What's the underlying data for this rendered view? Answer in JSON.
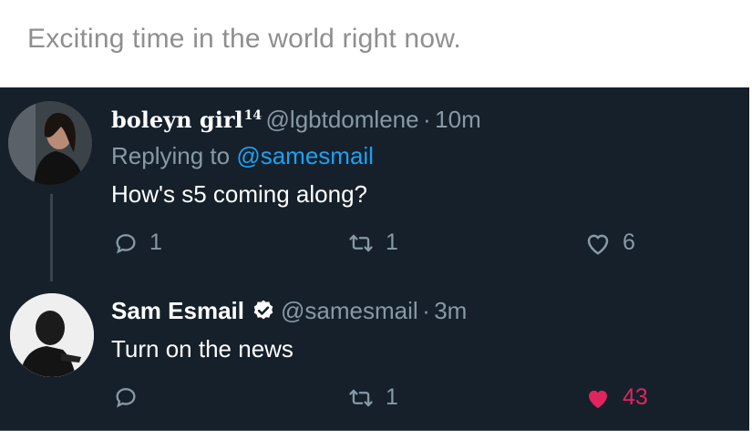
{
  "caption": "Exciting time in the world right now.",
  "tweets": [
    {
      "display_name": "boleyn girl",
      "name_suffix": "14",
      "handle": "@lgbtdomlene",
      "separator": "·",
      "time": "10m",
      "replying_label": "Replying to",
      "replying_to": "@samesmail",
      "text": "How's s5 coming along?",
      "replies": "1",
      "retweets": "1",
      "likes": "6"
    },
    {
      "display_name": "Sam Esmail",
      "handle": "@samesmail",
      "separator": "·",
      "time": "3m",
      "text": "Turn on the news",
      "replies": "",
      "retweets": "1",
      "likes": "43"
    }
  ],
  "colors": {
    "background": "#15202b",
    "text": "#ffffff",
    "muted": "#8899a6",
    "mention": "#1da1f2",
    "like": "#e0245e",
    "caption": "#8f8f8f"
  },
  "icons": [
    "reply-icon",
    "retweet-icon",
    "heart-icon",
    "heart-filled-icon",
    "verified-badge-icon"
  ]
}
